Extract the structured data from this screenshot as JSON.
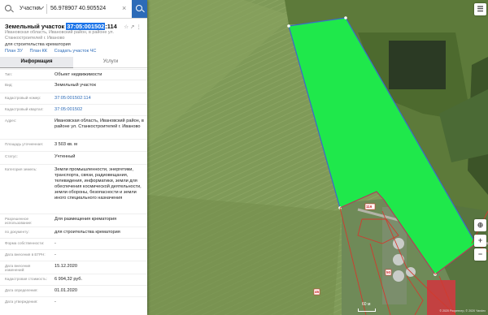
{
  "search": {
    "category": "Участки",
    "query": "56.978907 40.905524"
  },
  "parcel": {
    "title_prefix": "Земельный участок",
    "title_highlight": "37:05:001502",
    "title_suffix": ":114",
    "address": "Ивановская область, Ивановский район, в районе ул. Станкостроителей г. Иваново",
    "purpose": "для строительства крематория"
  },
  "actions": [
    "План ЗУ",
    "План КК",
    "Создать участок ЧС"
  ],
  "tabs": [
    "Информация",
    "Услуги"
  ],
  "info": [
    {
      "label": "Тип:",
      "value": "Объект недвижимости"
    },
    {
      "label": "Вид:",
      "value": "Земельный участок"
    },
    {
      "label": "Кадастровый номер:",
      "value": "37:05:001502:114",
      "link": true
    },
    {
      "label": "Кадастровый квартал:",
      "value": "37:05:001502",
      "link": true
    },
    {
      "label": "Адрес:",
      "value": "Ивановская область, Ивановский район, в районе ул. Станкостроителей г. Иваново"
    },
    {
      "label": "Площадь уточненная:",
      "value": "3 503 кв. м"
    },
    {
      "label": "Статус:",
      "value": "Учтенный"
    },
    {
      "label": "Категория земель:",
      "value": "Земли промышленности, энергетики, транспорта, связи, радиовещания, телевидения, информатики, земли для обеспечения космической деятельности, земли обороны, безопасности и земли иного специального назначения"
    },
    {
      "label": "Разрешенное использование:",
      "value": "Для размещения крематория"
    },
    {
      "label": "по документу:",
      "value": "для строительства крематория"
    },
    {
      "label": "Форма собственности:",
      "value": "-"
    },
    {
      "label": "Дата внесения в ЕГРН:",
      "value": "-"
    },
    {
      "label": "Дата внесения изменений:",
      "value": "15.12.2020"
    },
    {
      "label": "Кадастровая стоимость:",
      "value": "6 994,32 руб."
    },
    {
      "label": "Дата определения:",
      "value": "01.01.2020"
    },
    {
      "label": "Дата утверждения:",
      "value": "-"
    }
  ],
  "map": {
    "parcel_labels": [
      "116",
      "50",
      "45"
    ],
    "scale": "60 м",
    "attribution": "© 2020 Росреестр, © 2020 Yandex"
  },
  "colors": {
    "parcel_fill": "#1fe84b",
    "parcel_border": "#3b6bc9",
    "boundary": "#d23a2e",
    "accent": "#2c6bb8"
  }
}
